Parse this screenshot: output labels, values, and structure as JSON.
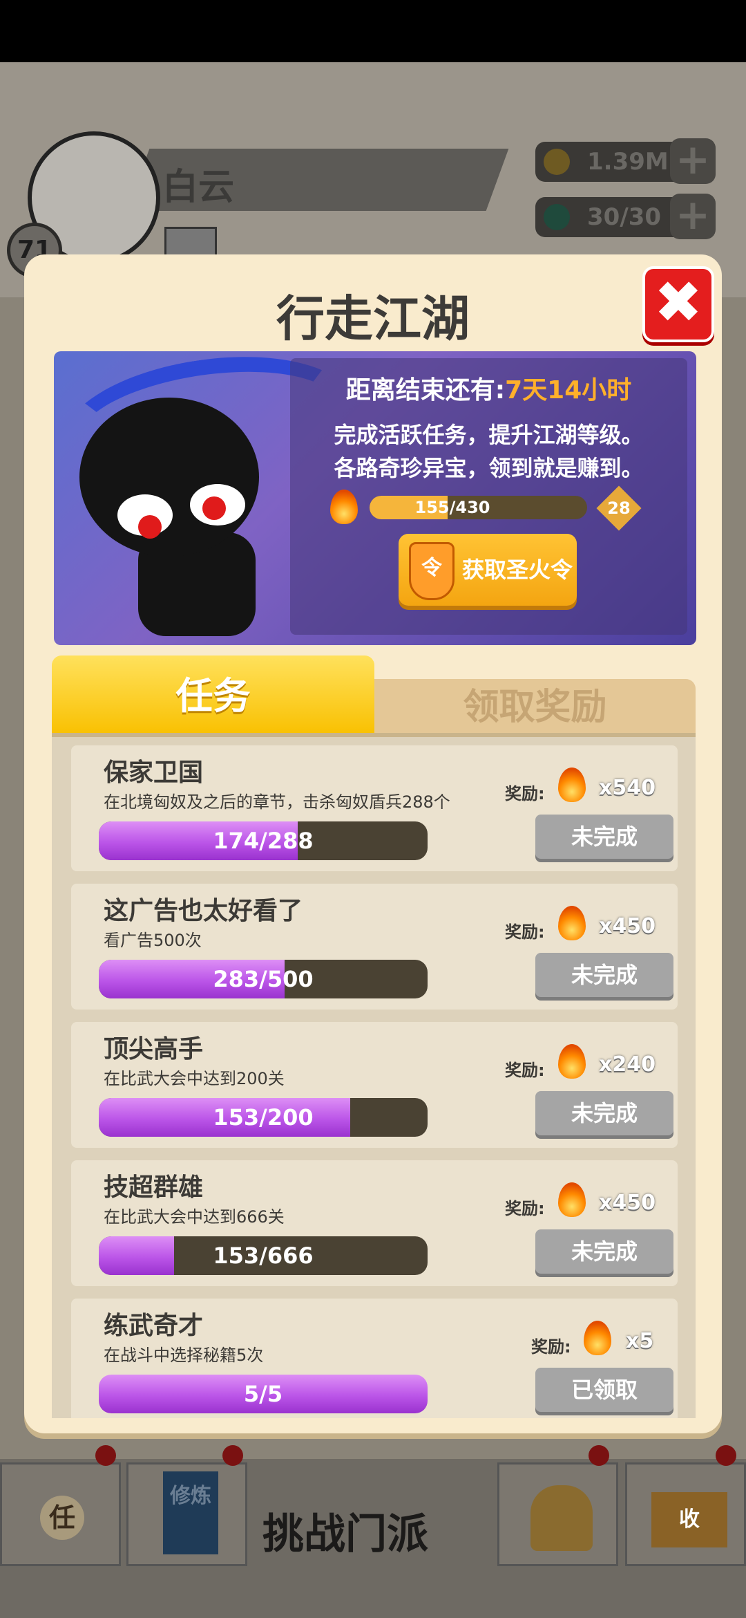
{
  "background": {
    "player_name": "白云",
    "player_level": "71",
    "gold": "1.39M",
    "energy": "30/30",
    "bottom_nav": {
      "task_icon_label": "任",
      "train_icon_label": "修炼",
      "challenge_label": "挑战门派",
      "collect_icon_label": "收"
    }
  },
  "modal": {
    "title": "行走江湖",
    "close_label": "✖",
    "countdown_label": "距离结束还有:",
    "countdown_value": "7天14小时",
    "desc_line1": "完成活跃任务，提升江湖等级。",
    "desc_line2": "各路奇珍异宝，领到就是赚到。",
    "level_progress": "155/430",
    "level_progress_fraction": 0.36,
    "level_badge": "28",
    "get_button_label": "获取圣火令",
    "get_button_icon_label": "令",
    "tabs": [
      {
        "label": "任务",
        "active": true
      },
      {
        "label": "领取奖励",
        "active": false
      }
    ],
    "reward_label": "奖励:",
    "tasks": [
      {
        "name": "保家卫国",
        "desc": "在北境匈奴及之后的章节，击杀匈奴盾兵288个",
        "progress": "174/288",
        "fraction": 0.604,
        "reward": "x540",
        "status": "未完成"
      },
      {
        "name": "这广告也太好看了",
        "desc": "看广告500次",
        "progress": "283/500",
        "fraction": 0.566,
        "reward": "x450",
        "status": "未完成"
      },
      {
        "name": "顶尖高手",
        "desc": "在比武大会中达到200关",
        "progress": "153/200",
        "fraction": 0.765,
        "reward": "x240",
        "status": "未完成"
      },
      {
        "name": "技超群雄",
        "desc": "在比武大会中达到666关",
        "progress": "153/666",
        "fraction": 0.23,
        "reward": "x450",
        "status": "未完成"
      },
      {
        "name": "练武奇才",
        "desc": "在战斗中选择秘籍5次",
        "progress": "5/5",
        "fraction": 1.0,
        "reward": "x5",
        "status": "已领取"
      }
    ]
  },
  "colors": {
    "modal_bg": "#f9ebcd",
    "tab_active": "#f9c103",
    "progress_purple": "#bb55e8",
    "close_red": "#e41e1e",
    "button_orange": "#f4a511",
    "status_gray": "#a5a5a5"
  }
}
